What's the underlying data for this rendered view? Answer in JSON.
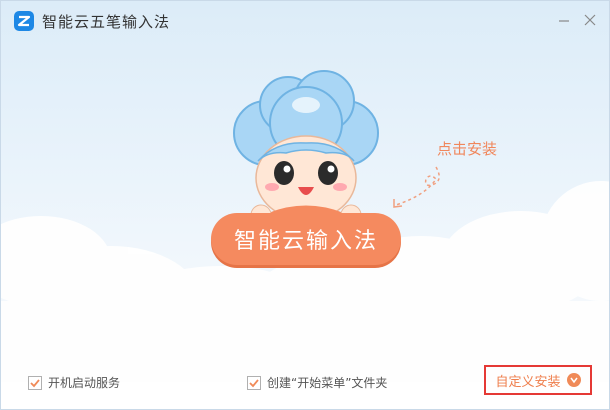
{
  "window": {
    "title": "智能云五笔输入法"
  },
  "titlebar": {
    "minimize_icon": "minimize-icon",
    "close_icon": "close-icon"
  },
  "hero": {
    "hint": "点击安装",
    "install_button": "智能云输入法"
  },
  "options": {
    "autostart": {
      "label": "开机启动服务",
      "checked": true
    },
    "start_menu": {
      "label": "创建“开始菜单”文件夹",
      "checked": true
    }
  },
  "custom_install": {
    "label": "自定义安装",
    "icon": "chevron-down-icon"
  },
  "colors": {
    "accent": "#f58a5f",
    "brand_blue": "#1e88e5",
    "highlight_border": "#e53935"
  }
}
